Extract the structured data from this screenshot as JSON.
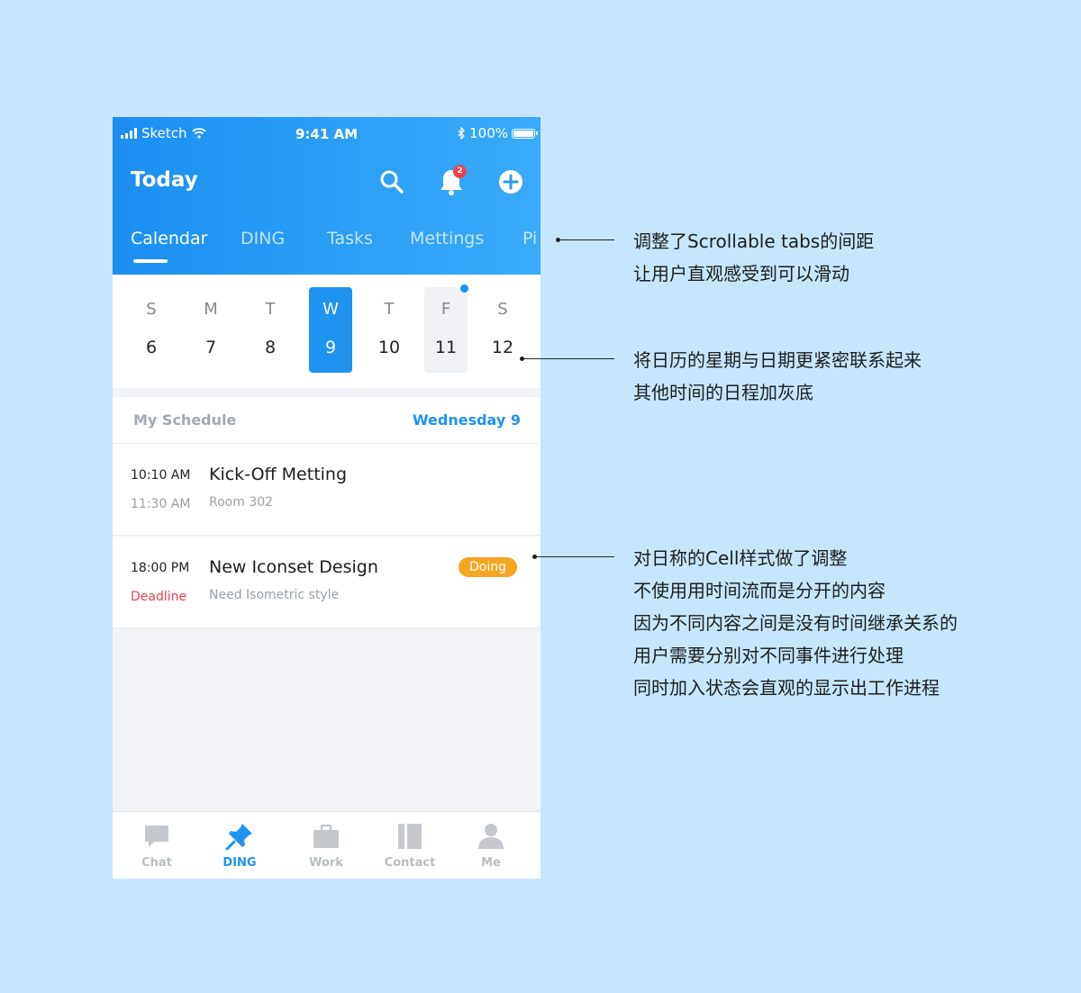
{
  "status_bar": {
    "carrier": "Sketch",
    "time": "9:41 AM",
    "battery": "100%"
  },
  "header": {
    "title": "Today",
    "notification_count": "2",
    "tabs": [
      {
        "label": "Calendar",
        "active": true
      },
      {
        "label": "DING"
      },
      {
        "label": "Tasks"
      },
      {
        "label": "Mettings"
      },
      {
        "label": "Pi"
      }
    ]
  },
  "calendar": {
    "days": [
      {
        "weekday": "S",
        "date": "6"
      },
      {
        "weekday": "M",
        "date": "7"
      },
      {
        "weekday": "T",
        "date": "8"
      },
      {
        "weekday": "W",
        "date": "9",
        "selected": true
      },
      {
        "weekday": "T",
        "date": "10"
      },
      {
        "weekday": "F",
        "date": "11",
        "greyed": true,
        "has_event_dot": true
      },
      {
        "weekday": "S",
        "date": "12"
      }
    ]
  },
  "schedule": {
    "heading": "My Schedule",
    "selected_day": "Wednesday 9",
    "items": [
      {
        "start": "10:10 AM",
        "end": "11:30 AM",
        "title": "Kick-Off Metting",
        "subtitle": "Room 302"
      },
      {
        "start": "18:00 PM",
        "end": "Deadline",
        "title": "New Iconset Design",
        "subtitle": "Need Isometric style",
        "status": "Doing"
      }
    ]
  },
  "bottom_nav": [
    {
      "label": "Chat"
    },
    {
      "label": "DING",
      "active": true
    },
    {
      "label": "Work"
    },
    {
      "label": "Contact"
    },
    {
      "label": "Me"
    }
  ],
  "annotations": [
    {
      "lines": [
        "调整了Scrollable tabs的间距",
        "让用户直观感受到可以滑动"
      ]
    },
    {
      "lines": [
        "将日历的星期与日期更紧密联系起来",
        "其他时间的日程加灰底"
      ]
    },
    {
      "lines": [
        "对日称的Cell样式做了调整",
        "不使用用时间流而是分开的内容",
        "因为不同内容之间是没有时间继承关系的",
        "用户需要分别对不同事件进行处理",
        "同时加入状态会直观的显示出工作进程"
      ]
    }
  ],
  "colors": {
    "background": "#c7e6fb",
    "header_blue": "#1c8ef1",
    "accent": "#1e93f0",
    "status_doing": "#f5a623",
    "deadline_red": "#f0414b"
  }
}
